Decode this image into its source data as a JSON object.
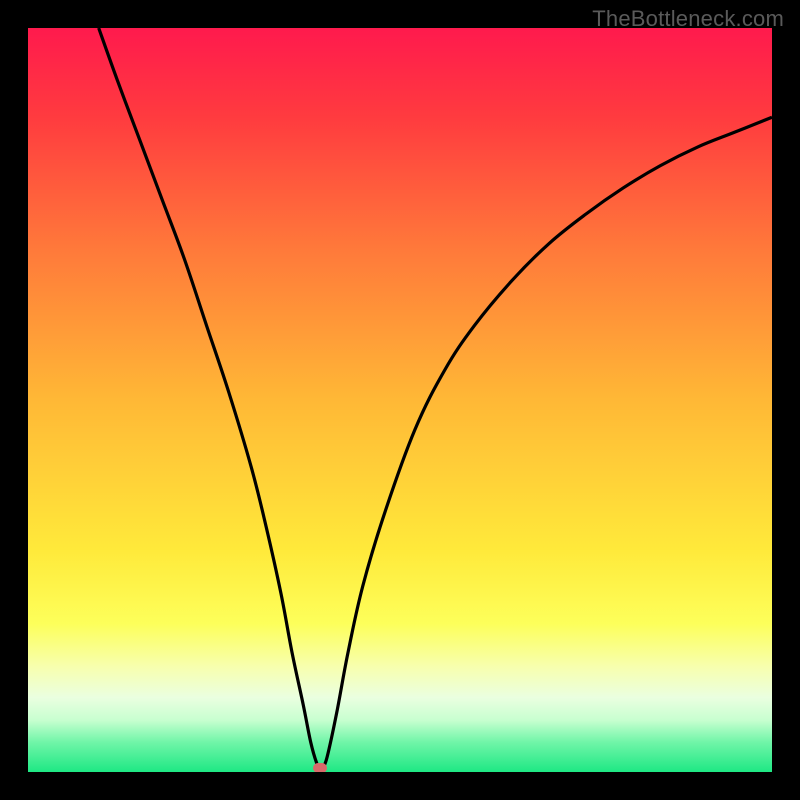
{
  "watermark": "TheBottleneck.com",
  "colors": {
    "bg_black": "#000000",
    "curve": "#000000",
    "marker": "#d96a6a",
    "watermark": "#5a5a5a"
  },
  "chart_data": {
    "type": "line",
    "title": "",
    "xlabel": "",
    "ylabel": "",
    "xlim": [
      0,
      100
    ],
    "ylim": [
      0,
      100
    ],
    "gradient_stops": [
      {
        "offset": 0.0,
        "color": "#ff1a4d"
      },
      {
        "offset": 0.12,
        "color": "#ff3b3f"
      },
      {
        "offset": 0.3,
        "color": "#ff7a3a"
      },
      {
        "offset": 0.5,
        "color": "#ffb836"
      },
      {
        "offset": 0.7,
        "color": "#ffe93a"
      },
      {
        "offset": 0.8,
        "color": "#fdff5a"
      },
      {
        "offset": 0.86,
        "color": "#f7ffb0"
      },
      {
        "offset": 0.9,
        "color": "#eaffe0"
      },
      {
        "offset": 0.93,
        "color": "#c8ffd0"
      },
      {
        "offset": 0.96,
        "color": "#70f5a8"
      },
      {
        "offset": 1.0,
        "color": "#1ee884"
      }
    ],
    "series": [
      {
        "name": "bottleneck-curve",
        "x": [
          9.5,
          12,
          15,
          18,
          21,
          24,
          27,
          30,
          32,
          34,
          35.5,
          37,
          38,
          38.8,
          39.3,
          39.6,
          40.2,
          41.5,
          43,
          45,
          48,
          52,
          56,
          60,
          65,
          70,
          75,
          80,
          85,
          90,
          95,
          100
        ],
        "y": [
          100,
          93,
          85,
          77,
          69,
          60,
          51,
          41,
          33,
          24,
          16,
          9,
          4,
          1.2,
          0.4,
          0.6,
          2,
          8,
          16,
          25,
          35,
          46,
          54,
          60,
          66,
          71,
          75,
          78.5,
          81.5,
          84,
          86,
          88
        ]
      }
    ],
    "markers": [
      {
        "name": "min-point",
        "x": 39.2,
        "y": 0.6
      }
    ]
  }
}
